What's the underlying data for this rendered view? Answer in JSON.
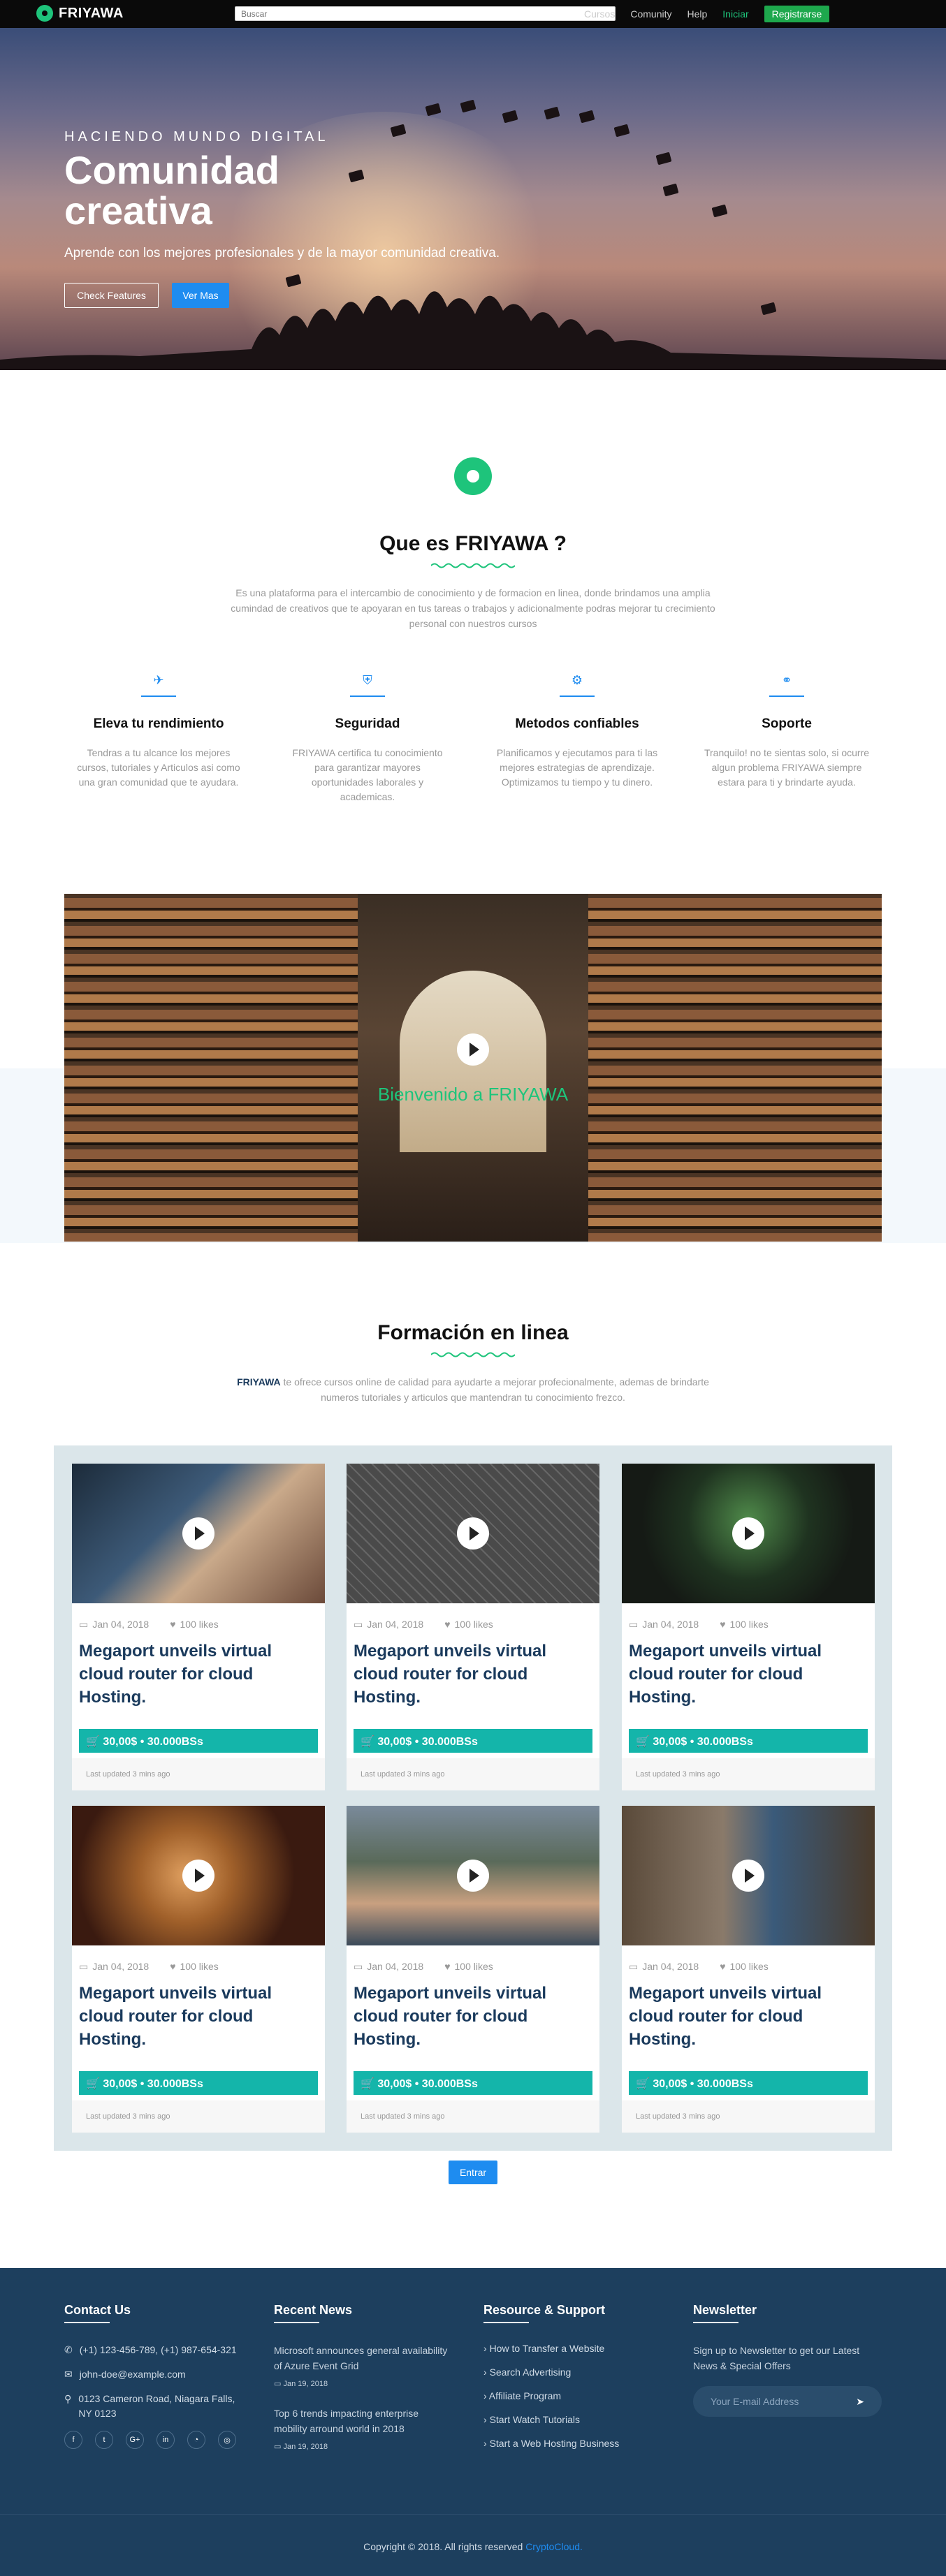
{
  "nav": {
    "brand": "FRIYAWA",
    "search_placeholder": "Buscar",
    "links": [
      "Cursos",
      "Comunity",
      "Help"
    ],
    "login": "Iniciar",
    "register": "Registrarse"
  },
  "hero": {
    "kicker": "HACIENDO MUNDO DIGITAL",
    "title": "Comunidad creativa",
    "subtitle": "Aprende con los mejores profesionales y de la mayor comunidad creativa.",
    "btn_features": "Check Features",
    "btn_more": "Ver Mas"
  },
  "about": {
    "title": "Que es FRIYAWA ?",
    "description": "Es una plataforma para el intercambio de conocimiento y de formacion en linea, donde brindamos una amplia cumindad de creativos que te apoyaran en tus tareas o trabajos y adicionalmente podras mejorar tu crecimiento personal con nuestros cursos",
    "features": [
      {
        "icon": "rocket-icon",
        "title": "Eleva tu rendimiento",
        "desc": "Tendras a tu alcance los mejores cursos, tutoriales y Articulos asi como una gran comunidad que te ayudara."
      },
      {
        "icon": "shield-icon",
        "title": "Seguridad",
        "desc": "FRIYAWA certifica tu conocimiento para garantizar mayores oportunidades laborales y academicas."
      },
      {
        "icon": "gear-icon",
        "title": "Metodos confiables",
        "desc": "Planificamos y ejecutamos para ti las mejores estrategias de aprendizaje. Optimizamos tu tiempo y tu dinero."
      },
      {
        "icon": "support-icon",
        "title": "Soporte",
        "desc": "Tranquilo! no te sientas solo, si ocurre algun problema FRIYAWA siempre estara para ti y brindarte ayuda."
      }
    ]
  },
  "video": {
    "caption": "Bienvenido a FRIYAWA"
  },
  "courses": {
    "title": "Formación en linea",
    "desc_brand": "FRIYAWA",
    "description": " te ofrece cursos online de calidad para ayudarte a mejorar profecionalmente, ademas de brindarte numeros tutoriales y articulos que mantendran tu conocimiento frezco.",
    "cards": [
      {
        "date": "Jan 04, 2018",
        "likes": "100 likes",
        "title": "Megaport unveils virtual cloud router for cloud Hosting.",
        "price": "30,00$ • 30.000BSs",
        "updated": "Last updated 3 mins ago"
      },
      {
        "date": "Jan 04, 2018",
        "likes": "100 likes",
        "title": "Megaport unveils virtual cloud router for cloud Hosting.",
        "price": "30,00$ • 30.000BSs",
        "updated": "Last updated 3 mins ago"
      },
      {
        "date": "Jan 04, 2018",
        "likes": "100 likes",
        "title": "Megaport unveils virtual cloud router for cloud Hosting.",
        "price": "30,00$ • 30.000BSs",
        "updated": "Last updated 3 mins ago"
      },
      {
        "date": "Jan 04, 2018",
        "likes": "100 likes",
        "title": "Megaport unveils virtual cloud router for cloud Hosting.",
        "price": "30,00$ • 30.000BSs",
        "updated": "Last updated 3 mins ago"
      },
      {
        "date": "Jan 04, 2018",
        "likes": "100 likes",
        "title": "Megaport unveils virtual cloud router for cloud Hosting.",
        "price": "30,00$ • 30.000BSs",
        "updated": "Last updated 3 mins ago"
      },
      {
        "date": "Jan 04, 2018",
        "likes": "100 likes",
        "title": "Megaport unveils virtual cloud router for cloud Hosting.",
        "price": "30,00$ • 30.000BSs",
        "updated": "Last updated 3 mins ago"
      }
    ],
    "enter": "Entrar"
  },
  "footer": {
    "contact": {
      "title": "Contact Us",
      "phone": "(+1) 123-456-789, (+1) 987-654-321",
      "email": "john-doe@example.com",
      "address": "0123 Cameron Road, Niagara Falls, NY 0123"
    },
    "news": {
      "title": "Recent News",
      "items": [
        {
          "text": "Microsoft announces general availability of Azure Event Grid",
          "date": "Jan 19, 2018"
        },
        {
          "text": "Top 6 trends impacting enterprise mobility arround world in 2018",
          "date": "Jan 19, 2018"
        }
      ]
    },
    "resources": {
      "title": "Resource & Support",
      "links": [
        "How to Transfer a Website",
        "Search Advertising",
        "Affiliate Program",
        "Start Watch Tutorials",
        "Start a Web Hosting Business"
      ]
    },
    "newsletter": {
      "title": "Newsletter",
      "text": "Sign up to Newsletter to get our Latest News & Special Offers",
      "placeholder": "Your E-mail Address"
    },
    "copyright": "Copyright © 2018. All rights reserved ",
    "copyright_brand": "CryptoCloud."
  }
}
